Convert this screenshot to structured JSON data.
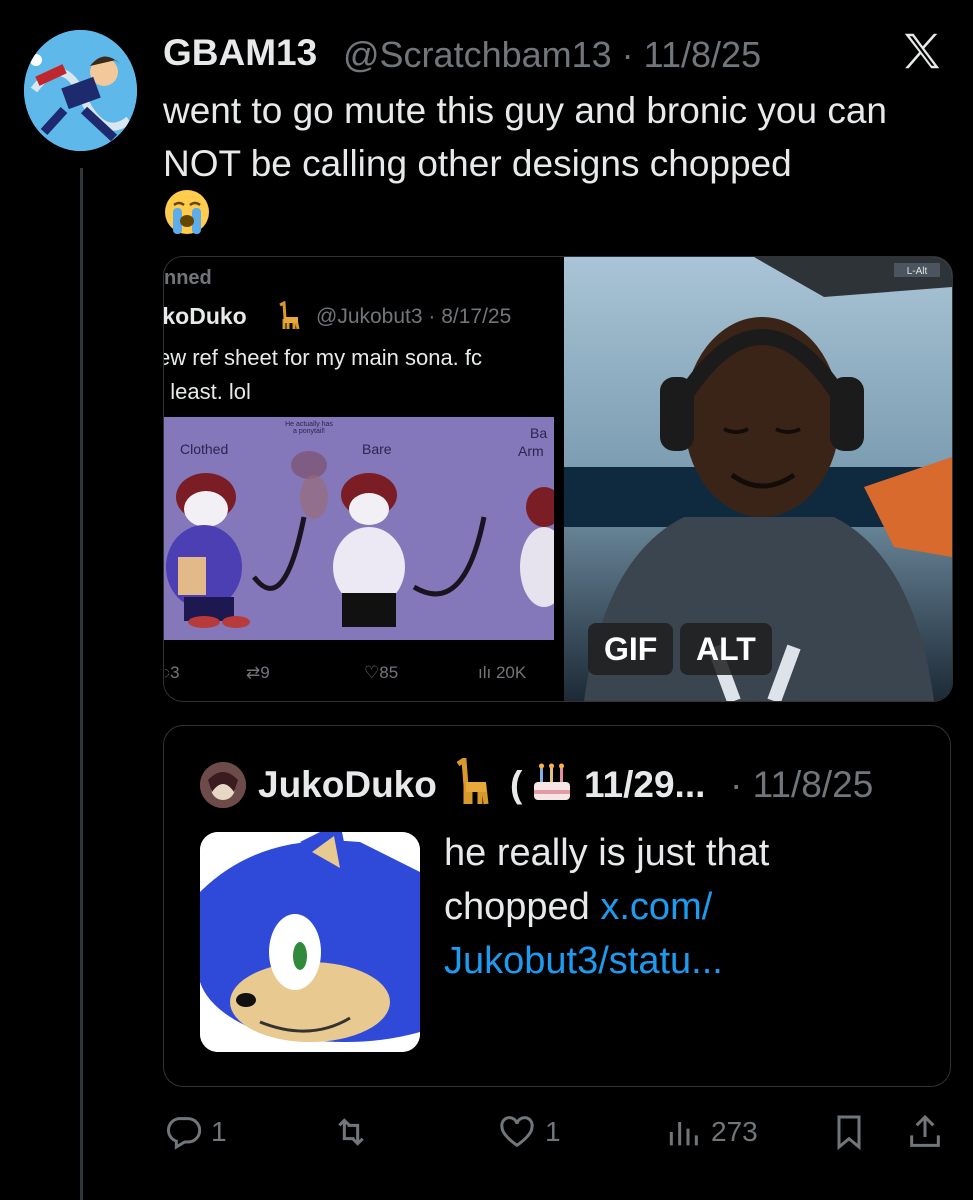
{
  "tweet": {
    "author_name": "GBAM13",
    "handle_date": "@Scratchbam13 · 11/8/25",
    "text": "went to go mute this guy and bronic you can NOT be calling other designs chopped",
    "emoji": "😭"
  },
  "media_screenshot": {
    "pinned": "nned",
    "name": "ıkoDuko",
    "handle_date": "@Jukobut3 · 8/17/25",
    "line1": "ew ref sheet for my main sona. fc",
    "line2": "t least. lol",
    "art_labels": [
      "Clothed",
      "He actually has a ponytail!",
      "Bare",
      "Ba",
      "Arm"
    ],
    "stats": {
      "replies": "3",
      "reposts": "9",
      "likes": "85",
      "views": "20K"
    }
  },
  "media_gif": {
    "gif_label": "GIF",
    "alt_label": "ALT",
    "stream_overlay": "L-Alt"
  },
  "quote": {
    "name": "JukoDuko",
    "paren": "(",
    "nick": "11/29...",
    "date": "· 11/8/25",
    "text": "he really is just that chopped ",
    "link_text": "x.com/ Jukobut3/statu..."
  },
  "actions": {
    "replies": "1",
    "reposts": "",
    "likes": "1",
    "views": "273"
  },
  "colors": {
    "background": "#000000",
    "text": "#e7e9ea",
    "secondary": "#71767b",
    "link": "#1d9bf0",
    "border": "#2f3336"
  }
}
